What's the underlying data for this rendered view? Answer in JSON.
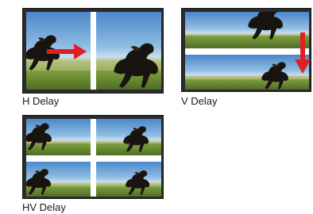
{
  "panels": {
    "h_delay": {
      "label": "H Delay"
    },
    "v_delay": {
      "label": "V Delay"
    },
    "hv_delay": {
      "label": "HV Delay"
    }
  },
  "colors": {
    "arrow": "#e02020",
    "frame": "#2b2b2b",
    "separator": "#ffffff"
  }
}
